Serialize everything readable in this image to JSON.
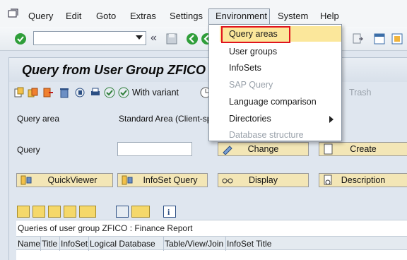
{
  "menubar": {
    "items": [
      {
        "label": "Query"
      },
      {
        "label": "Edit"
      },
      {
        "label": "Goto"
      },
      {
        "label": "Extras"
      },
      {
        "label": "Settings"
      },
      {
        "label": "Environment"
      },
      {
        "label": "System"
      },
      {
        "label": "Help"
      }
    ]
  },
  "toolbar": {
    "command_field_value": "",
    "icons": [
      "sap-menu-icon",
      "check-icon",
      "dropdown-icon",
      "double-left-icon",
      "save-icon",
      "back-icon",
      "layout-icon",
      "shortcut-icon",
      "help-icon"
    ]
  },
  "main": {
    "title": "Query from User Group ZFICO",
    "app_toolbar": {
      "with_variant_label": "With variant",
      "trash_label": "Trash"
    },
    "query_area_label": "Query area",
    "query_area_value": "Standard Area (Client-sp",
    "query_label": "Query",
    "query_value": "",
    "buttons": {
      "change": "Change",
      "create": "Create",
      "quickviewer": "QuickViewer",
      "infoset_query": "InfoSet Query",
      "display": "Display",
      "description": "Description"
    },
    "table": {
      "title": "Queries of user group ZFICO : Finance Report",
      "columns": [
        "Name",
        "Title",
        "InfoSet",
        "Logical Database",
        "Table/View/Join",
        "InfoSet Title"
      ]
    }
  },
  "environment_menu": {
    "items": [
      {
        "label": "Query areas",
        "enabled": true,
        "highlighted": true
      },
      {
        "label": "User groups",
        "enabled": true
      },
      {
        "label": "InfoSets",
        "enabled": true
      },
      {
        "label": "SAP Query",
        "enabled": false
      },
      {
        "label": "Language comparison",
        "enabled": true
      },
      {
        "label": "Directories",
        "enabled": true,
        "submenu": true
      },
      {
        "label": "Database structure",
        "enabled": false
      }
    ]
  },
  "colors": {
    "highlight": "#fbe79b",
    "highlight_border": "#e0141e",
    "button_bg": "#f3e6b6",
    "background": "#dfe6ef"
  }
}
